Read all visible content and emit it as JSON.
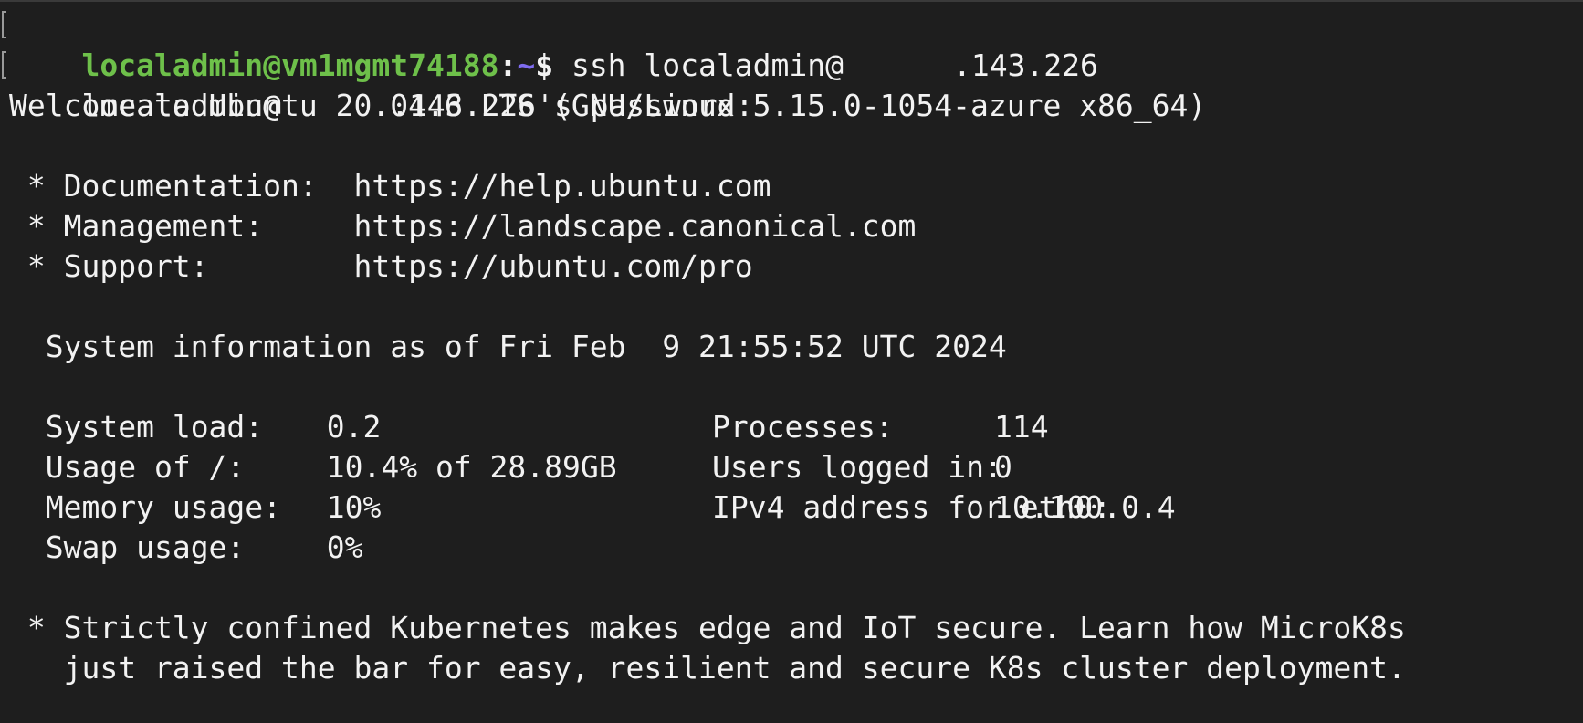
{
  "prompt": {
    "user_host": "localadmin@vm1mgmt74188",
    "separator": ":",
    "path": "~",
    "symbol": "$",
    "command_prefix": " ssh localadmin@",
    "command_suffix": ".143.226"
  },
  "password_line": {
    "prefix": "localadmin@",
    "suffix": ".143.226's password:"
  },
  "welcome": "Welcome to Ubuntu 20.04.6 LTS (GNU/Linux 5.15.0-1054-azure x86_64)",
  "links": [
    {
      "label": " * Documentation:  ",
      "url": "https://help.ubuntu.com"
    },
    {
      "label": " * Management:     ",
      "url": "https://landscape.canonical.com"
    },
    {
      "label": " * Support:        ",
      "url": "https://ubuntu.com/pro"
    }
  ],
  "sysinfo_header": "  System information as of Fri Feb  9 21:55:52 UTC 2024",
  "sysinfo_left": [
    {
      "label": "System load:",
      "value": "0.2"
    },
    {
      "label": "Usage of /:",
      "value": "10.4% of 28.89GB"
    },
    {
      "label": "Memory usage:",
      "value": "10%"
    },
    {
      "label": "Swap usage:",
      "value": "0%"
    }
  ],
  "sysinfo_right": [
    {
      "label": "Processes:",
      "value": "114"
    },
    {
      "label": "Users logged in:",
      "value": "0"
    },
    {
      "label": "IPv4 address for eth0:",
      "value": "10.100.0.4"
    }
  ],
  "notice": [
    " * Strictly confined Kubernetes makes edge and IoT secure. Learn how MicroK8s",
    "   just raised the bar for easy, resilient and secure K8s cluster deployment."
  ]
}
